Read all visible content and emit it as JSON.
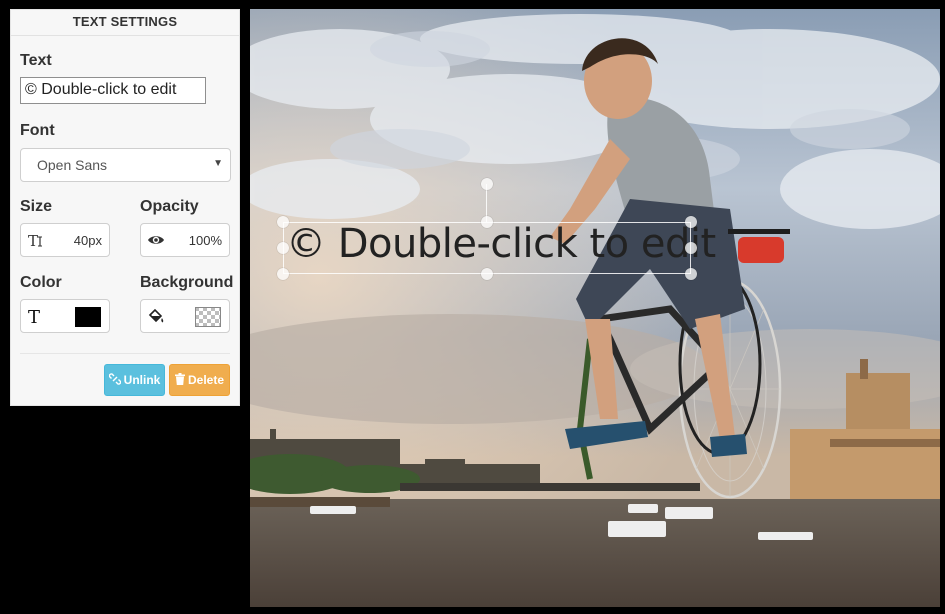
{
  "panel": {
    "title": "TEXT SETTINGS",
    "text_label": "Text",
    "text_value": "© Double-click to edit",
    "font_label": "Font",
    "font_value": "Open Sans",
    "size_label": "Size",
    "size_value": "40px",
    "opacity_label": "Opacity",
    "opacity_value": "100%",
    "color_label": "Color",
    "color_value": "#000000",
    "background_label": "Background",
    "background_value": "transparent",
    "unlink_label": "Unlink",
    "delete_label": "Delete"
  },
  "canvas": {
    "overlay_text": "© Double-click to edit"
  },
  "icons": {
    "size": "text-size-icon",
    "opacity": "eye-icon",
    "color": "text-color-icon",
    "background": "paint-bucket-icon",
    "unlink": "unlink-icon",
    "delete": "trash-icon"
  },
  "colors": {
    "unlink_button": "#5bc0de",
    "delete_button": "#f0ad4e",
    "text_color_swatch": "#000000"
  }
}
